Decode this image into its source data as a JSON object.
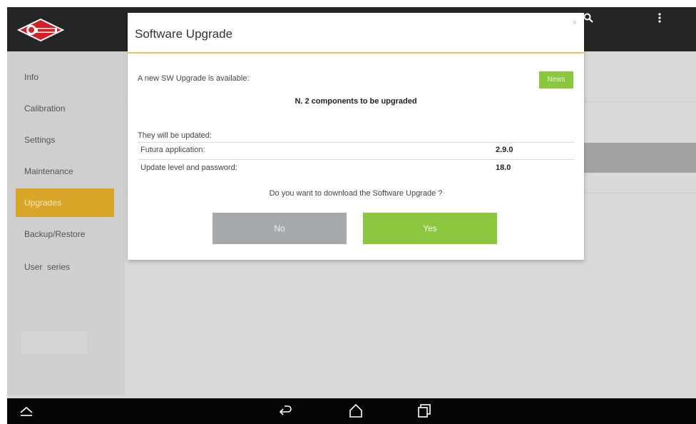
{
  "topbar": {
    "search_icon": "search-icon",
    "menu_icon": "overflow-menu-icon"
  },
  "sidebar": {
    "items": [
      {
        "label": "Info",
        "active": false
      },
      {
        "label": "Calibration",
        "active": false
      },
      {
        "label": "Settings",
        "active": false
      },
      {
        "label": "Maintenance",
        "active": false
      },
      {
        "label": "Upgrades",
        "active": true
      },
      {
        "label": "Backup/Restore",
        "active": false
      },
      {
        "label": "User  series",
        "active": false
      }
    ]
  },
  "dialog": {
    "title": "Software Upgrade",
    "close": "×",
    "available_text": "A new SW Upgrade is available:",
    "news_label": "News",
    "components_text": "N. 2 components to be upgraded",
    "updated_header": "They will be updated:",
    "rows": [
      {
        "name": "Futura application:",
        "value": "2.9.0"
      },
      {
        "name": "Update level and password:",
        "value": "18.0"
      }
    ],
    "question": "Do you want to download the Software Upgrade ?",
    "no_label": "No",
    "yes_label": "Yes"
  },
  "colors": {
    "accent": "#d9a62a",
    "green": "#8dc63f",
    "gray_button": "#a7aaad"
  }
}
